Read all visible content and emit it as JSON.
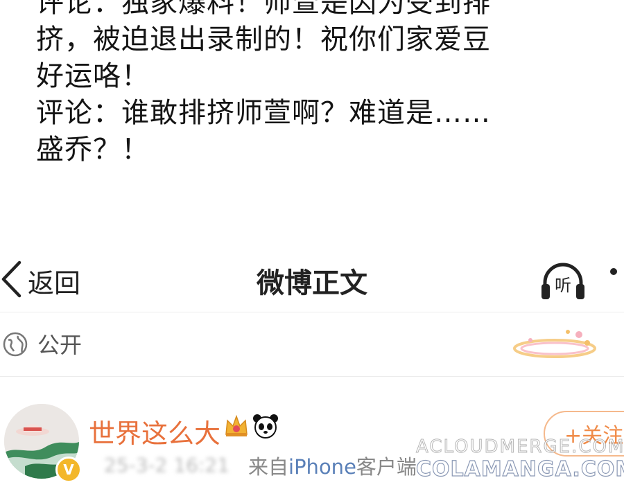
{
  "caption": {
    "lines": [
      "评论：独家爆料！师萱是因为受到排",
      "挤，被迫退出录制的！祝你们家爱豆",
      "好运咯！",
      "评论：谁敢排挤师萱啊？难道是……",
      "盛乔？！"
    ]
  },
  "navbar": {
    "back_label": "返回",
    "back_icon": "chevron-left-icon",
    "title": "微博正文",
    "listen_label": "听",
    "listen_icon": "headphones-icon",
    "more_icon": "more-dots-icon"
  },
  "visibility": {
    "icon": "globe-icon",
    "label": "公开"
  },
  "post": {
    "author_name": "世界这么大",
    "author_color": "#e8713c",
    "badges": [
      "crown-icon",
      "panda-icon"
    ],
    "verified_icon": "verified-v-icon",
    "verified_mark": "V",
    "timestamp": "25-3-2 16:21",
    "source_prefix": "来自",
    "source_device": "iPhone",
    "source_suffix": "客户端",
    "follow_label": "+关注"
  },
  "watermark": {
    "line1": "ACLOUDMERGE.COM",
    "line2": "COLAMANGA.COM"
  }
}
